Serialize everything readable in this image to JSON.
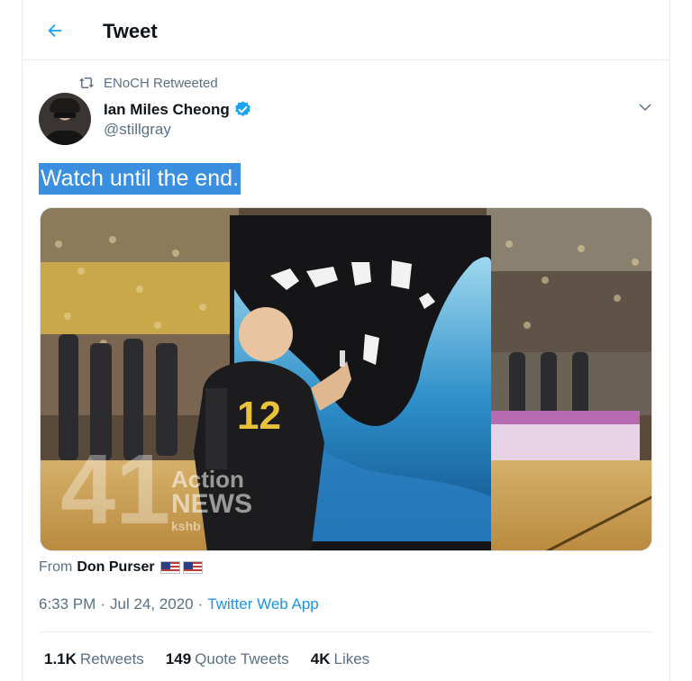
{
  "header": {
    "title": "Tweet",
    "back_icon": "arrow-left-icon",
    "accent": "#1da1f2"
  },
  "retweet": {
    "icon": "retweet-icon",
    "text": "ENoCH Retweeted"
  },
  "author": {
    "name": "Ian Miles Cheong",
    "handle": "@stillgray",
    "verified_icon": "verified-badge-icon"
  },
  "tweet": {
    "text": "Watch until the end.",
    "selection_color": "#3a8fe0"
  },
  "media": {
    "jersey_number": "12",
    "watermark_number": "41",
    "watermark_line1": "Action",
    "watermark_line2": "NEWS",
    "watermark_line3": "kshb"
  },
  "from": {
    "label": "From",
    "name": "Don Purser",
    "flags_icon": "us-flag-icon"
  },
  "meta": {
    "time": "6:33 PM",
    "separator": "·",
    "date": "Jul 24, 2020",
    "app": "Twitter Web App",
    "link_color": "#1b95e0"
  },
  "stats": {
    "retweets": {
      "count": "1.1K",
      "label": "Retweets"
    },
    "quotes": {
      "count": "149",
      "label": "Quote Tweets"
    },
    "likes": {
      "count": "4K",
      "label": "Likes"
    }
  }
}
